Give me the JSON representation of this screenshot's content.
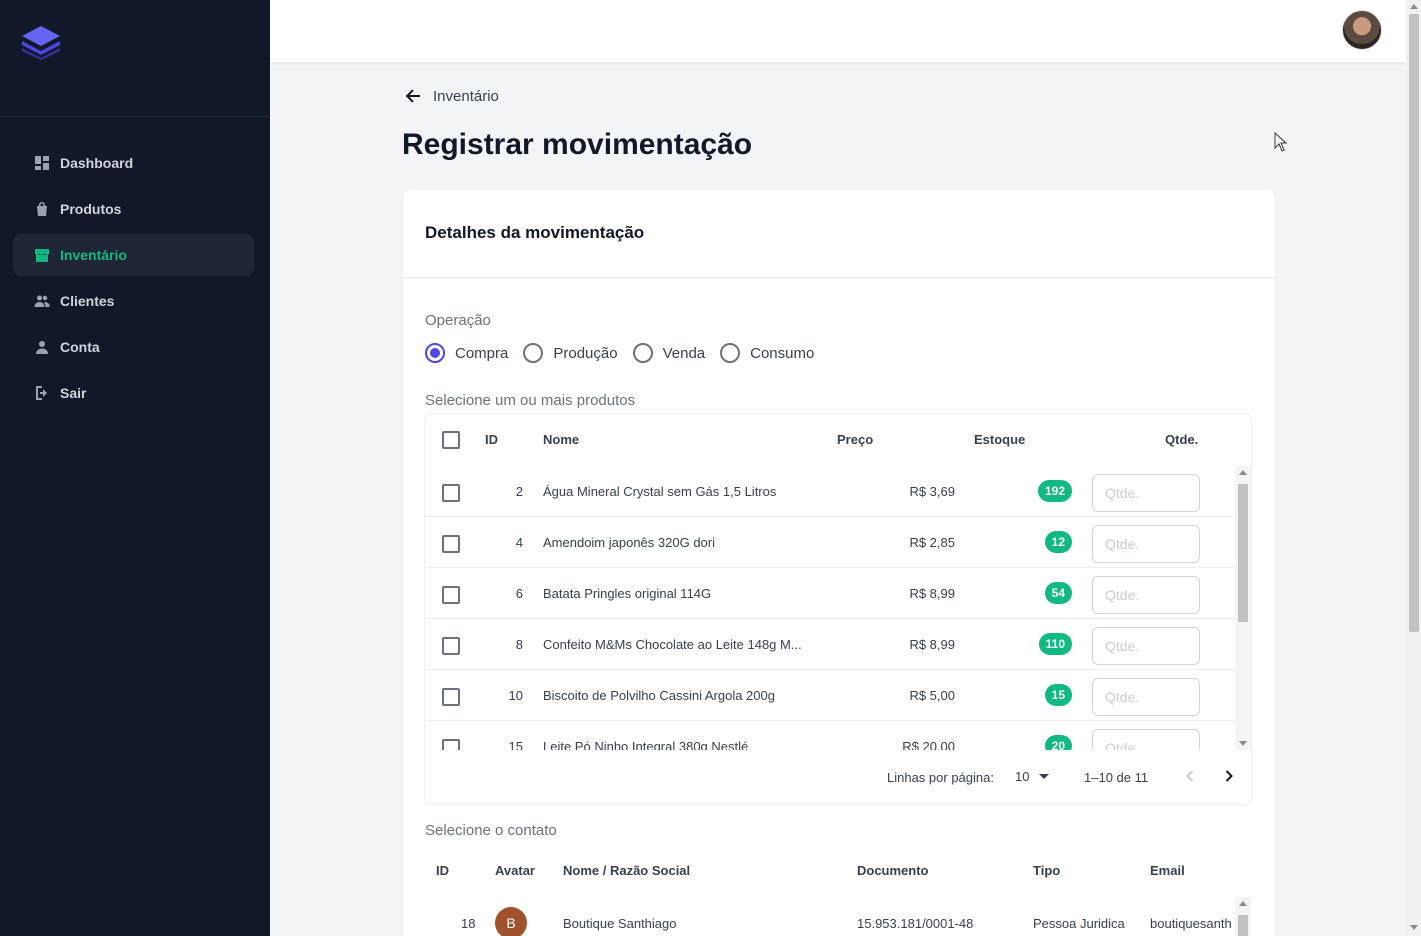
{
  "sidebar": {
    "items": [
      {
        "label": "Dashboard",
        "icon": "dashboard-icon"
      },
      {
        "label": "Produtos",
        "icon": "bag-icon"
      },
      {
        "label": "Inventário",
        "icon": "store-icon",
        "active": true
      },
      {
        "label": "Clientes",
        "icon": "people-icon"
      },
      {
        "label": "Conta",
        "icon": "person-icon"
      },
      {
        "label": "Sair",
        "icon": "logout-icon"
      }
    ]
  },
  "header": {
    "back_label": "Inventário",
    "page_title": "Registrar movimentação"
  },
  "card": {
    "title": "Detalhes da movimentação",
    "operation_label": "Operação",
    "operations": [
      "Compra",
      "Produção",
      "Venda",
      "Consumo"
    ],
    "selected_operation": "Compra",
    "products_label": "Selecione um ou mais produtos",
    "contact_label": "Selecione o contato"
  },
  "products_table": {
    "columns": {
      "id": "ID",
      "name": "Nome",
      "price": "Preço",
      "stock": "Estoque",
      "qty": "Qtde."
    },
    "qty_placeholder": "Qtde.",
    "rows": [
      {
        "id": "2",
        "name": "Água Mineral Crystal sem Gás 1,5 Litros",
        "price": "R$ 3,69",
        "stock": "192"
      },
      {
        "id": "4",
        "name": "Amendoim japonês 320G dori",
        "price": "R$ 2,85",
        "stock": "12"
      },
      {
        "id": "6",
        "name": "Batata Pringles original 114G",
        "price": "R$ 8,99",
        "stock": "54"
      },
      {
        "id": "8",
        "name": "Confeito M&Ms Chocolate ao Leite 148g M...",
        "price": "R$ 8,99",
        "stock": "110"
      },
      {
        "id": "10",
        "name": "Biscoito de Polvilho Cassini Argola 200g",
        "price": "R$ 5,00",
        "stock": "15"
      },
      {
        "id": "15",
        "name": "Leite Pó Ninho Integral 380g Nestlé",
        "price": "R$ 20,00",
        "stock": "20"
      }
    ],
    "pagination": {
      "rows_per_page_label": "Linhas por página:",
      "rows_per_page": "10",
      "range": "1–10 de 11"
    }
  },
  "contacts_table": {
    "columns": {
      "id": "ID",
      "avatar": "Avatar",
      "name": "Nome / Razão Social",
      "document": "Documento",
      "type": "Tipo",
      "email": "Email"
    },
    "rows": [
      {
        "id": "18",
        "avatar_letter": "B",
        "name": "Boutique Santhiago",
        "document": "15.953.181/0001-48",
        "type": "Pessoa Juridica",
        "email": "boutiquesanth"
      }
    ]
  },
  "colors": {
    "sidebar_bg": "#111827",
    "accent_green": "#10b981",
    "radio_primary": "#5048e5",
    "avatar_brown": "#a0522d"
  }
}
